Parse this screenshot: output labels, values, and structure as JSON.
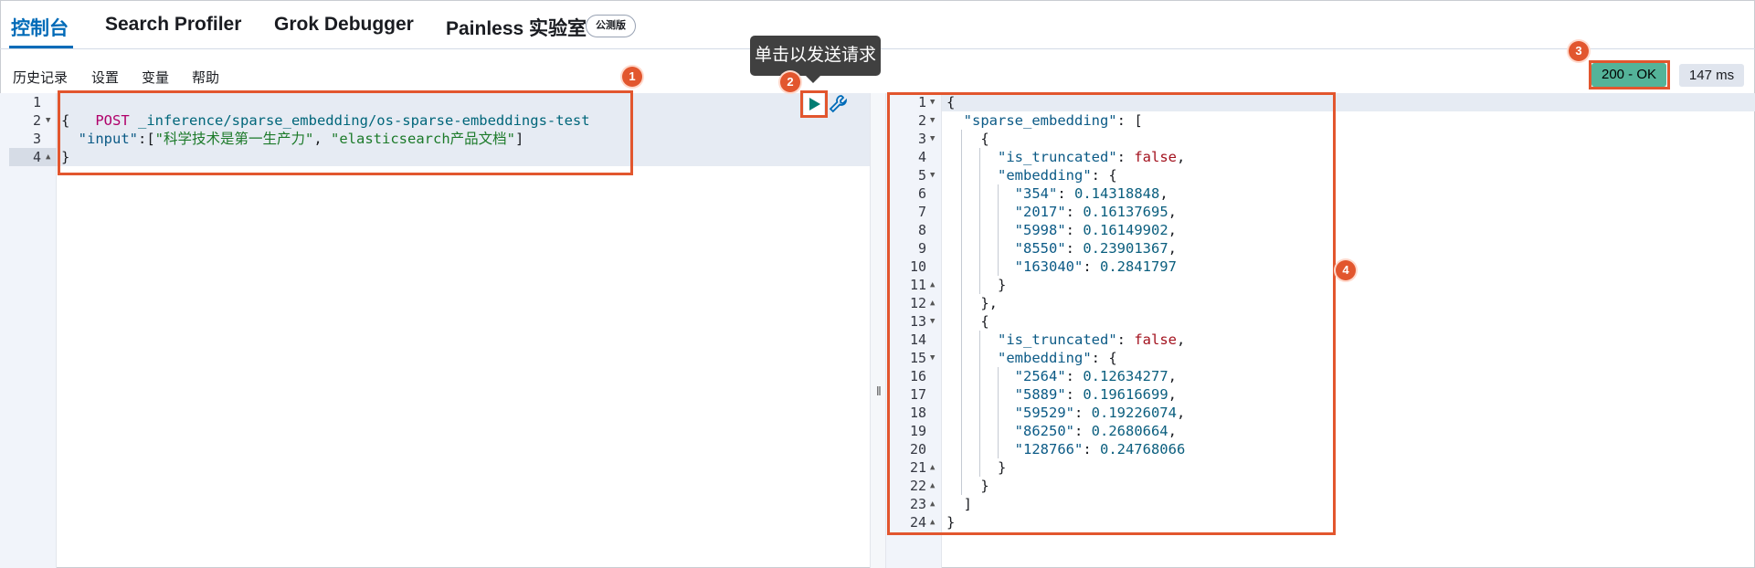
{
  "tabs": [
    {
      "label": "控制台"
    },
    {
      "label": "Search Profiler"
    },
    {
      "label": "Grok Debugger"
    },
    {
      "label": "Painless 实验室"
    }
  ],
  "beta_badge": "公测版",
  "menu": [
    "历史记录",
    "设置",
    "变量",
    "帮助"
  ],
  "tooltip": "单击以发送请求",
  "status": {
    "code_label": "200 - OK",
    "time_label": "147 ms",
    "ok_color": "#54b399"
  },
  "annotations": [
    "1",
    "2",
    "3",
    "4"
  ],
  "request": {
    "line_numbers": [
      "1",
      "2",
      "3",
      "4"
    ],
    "method": "POST",
    "path": "_inference/sparse_embedding/os-sparse-embeddings-test",
    "open_brace": "{",
    "input_key": "\"input\"",
    "input_open": ":[",
    "input_val1": "\"科学技术是第一生产力\"",
    "input_sep": ", ",
    "input_val2": "\"elasticsearch产品文档\"",
    "input_close": "]",
    "close_brace": "}"
  },
  "response": {
    "line_numbers": [
      "1",
      "2",
      "3",
      "4",
      "5",
      "6",
      "7",
      "8",
      "9",
      "10",
      "11",
      "12",
      "13",
      "14",
      "15",
      "16",
      "17",
      "18",
      "19",
      "20",
      "21",
      "22",
      "23",
      "24"
    ],
    "lines": [
      [
        {
          "t": "{",
          "c": "punc"
        }
      ],
      [
        {
          "t": "  ",
          "c": "punc"
        },
        {
          "t": "\"sparse_embedding\"",
          "c": "key"
        },
        {
          "t": ": [",
          "c": "punc"
        }
      ],
      [
        {
          "t": "    {",
          "c": "punc"
        }
      ],
      [
        {
          "t": "      ",
          "c": "punc"
        },
        {
          "t": "\"is_truncated\"",
          "c": "key"
        },
        {
          "t": ": ",
          "c": "punc"
        },
        {
          "t": "false",
          "c": "bool"
        },
        {
          "t": ",",
          "c": "punc"
        }
      ],
      [
        {
          "t": "      ",
          "c": "punc"
        },
        {
          "t": "\"embedding\"",
          "c": "key"
        },
        {
          "t": ": {",
          "c": "punc"
        }
      ],
      [
        {
          "t": "        ",
          "c": "punc"
        },
        {
          "t": "\"354\"",
          "c": "key"
        },
        {
          "t": ": ",
          "c": "punc"
        },
        {
          "t": "0.14318848",
          "c": "num"
        },
        {
          "t": ",",
          "c": "punc"
        }
      ],
      [
        {
          "t": "        ",
          "c": "punc"
        },
        {
          "t": "\"2017\"",
          "c": "key"
        },
        {
          "t": ": ",
          "c": "punc"
        },
        {
          "t": "0.16137695",
          "c": "num"
        },
        {
          "t": ",",
          "c": "punc"
        }
      ],
      [
        {
          "t": "        ",
          "c": "punc"
        },
        {
          "t": "\"5998\"",
          "c": "key"
        },
        {
          "t": ": ",
          "c": "punc"
        },
        {
          "t": "0.16149902",
          "c": "num"
        },
        {
          "t": ",",
          "c": "punc"
        }
      ],
      [
        {
          "t": "        ",
          "c": "punc"
        },
        {
          "t": "\"8550\"",
          "c": "key"
        },
        {
          "t": ": ",
          "c": "punc"
        },
        {
          "t": "0.23901367",
          "c": "num"
        },
        {
          "t": ",",
          "c": "punc"
        }
      ],
      [
        {
          "t": "        ",
          "c": "punc"
        },
        {
          "t": "\"163040\"",
          "c": "key"
        },
        {
          "t": ": ",
          "c": "punc"
        },
        {
          "t": "0.2841797",
          "c": "num"
        }
      ],
      [
        {
          "t": "      }",
          "c": "punc"
        }
      ],
      [
        {
          "t": "    },",
          "c": "punc"
        }
      ],
      [
        {
          "t": "    {",
          "c": "punc"
        }
      ],
      [
        {
          "t": "      ",
          "c": "punc"
        },
        {
          "t": "\"is_truncated\"",
          "c": "key"
        },
        {
          "t": ": ",
          "c": "punc"
        },
        {
          "t": "false",
          "c": "bool"
        },
        {
          "t": ",",
          "c": "punc"
        }
      ],
      [
        {
          "t": "      ",
          "c": "punc"
        },
        {
          "t": "\"embedding\"",
          "c": "key"
        },
        {
          "t": ": {",
          "c": "punc"
        }
      ],
      [
        {
          "t": "        ",
          "c": "punc"
        },
        {
          "t": "\"2564\"",
          "c": "key"
        },
        {
          "t": ": ",
          "c": "punc"
        },
        {
          "t": "0.12634277",
          "c": "num"
        },
        {
          "t": ",",
          "c": "punc"
        }
      ],
      [
        {
          "t": "        ",
          "c": "punc"
        },
        {
          "t": "\"5889\"",
          "c": "key"
        },
        {
          "t": ": ",
          "c": "punc"
        },
        {
          "t": "0.19616699",
          "c": "num"
        },
        {
          "t": ",",
          "c": "punc"
        }
      ],
      [
        {
          "t": "        ",
          "c": "punc"
        },
        {
          "t": "\"59529\"",
          "c": "key"
        },
        {
          "t": ": ",
          "c": "punc"
        },
        {
          "t": "0.19226074",
          "c": "num"
        },
        {
          "t": ",",
          "c": "punc"
        }
      ],
      [
        {
          "t": "        ",
          "c": "punc"
        },
        {
          "t": "\"86250\"",
          "c": "key"
        },
        {
          "t": ": ",
          "c": "punc"
        },
        {
          "t": "0.2680664",
          "c": "num"
        },
        {
          "t": ",",
          "c": "punc"
        }
      ],
      [
        {
          "t": "        ",
          "c": "punc"
        },
        {
          "t": "\"128766\"",
          "c": "key"
        },
        {
          "t": ": ",
          "c": "punc"
        },
        {
          "t": "0.24768066",
          "c": "num"
        }
      ],
      [
        {
          "t": "      }",
          "c": "punc"
        }
      ],
      [
        {
          "t": "    }",
          "c": "punc"
        }
      ],
      [
        {
          "t": "  ]",
          "c": "punc"
        }
      ],
      [
        {
          "t": "}",
          "c": "punc"
        }
      ]
    ]
  },
  "icons": {
    "run": "play-icon",
    "settings": "wrench-icon",
    "resize": "resize-grip-icon"
  }
}
